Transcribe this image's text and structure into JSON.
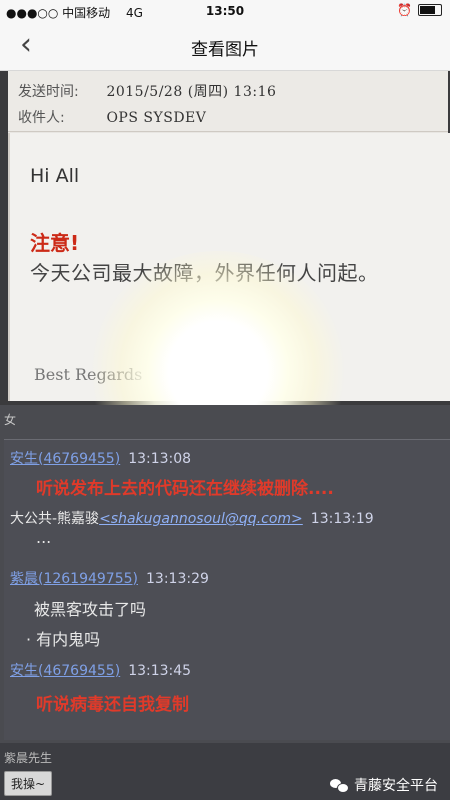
{
  "status_bar": {
    "carrier": "●●●○○ 中国移动",
    "network": "4G",
    "time": "13:50"
  },
  "nav": {
    "back_icon": "chevron-left-icon",
    "title": "查看图片"
  },
  "email": {
    "send_time_label": "发送时间:",
    "send_time_value": "2015/5/28 (周四) 13:16",
    "recipient_label": "收件人:",
    "recipient_value": "OPS SYSDEV",
    "greeting": "Hi All",
    "notice": "注意!",
    "line1": "今天公司最大故障，外界任何人问起。",
    "closing": "Best Regards"
  },
  "chat": {
    "title": "女",
    "messages": [
      {
        "sender": "安生(46769455)",
        "time": "13:13:08",
        "text": "听说发布上去的代码还在继续被删除...."
      },
      {
        "sender": "大公共-熊嘉骏",
        "email": "<shakugannosoul@qq.com>",
        "time": "13:13:19",
        "text": "..."
      },
      {
        "sender": "紫晨(1261949755)",
        "time": "13:13:29",
        "text": "被黑客攻击了吗",
        "text2": "· 有内鬼吗"
      },
      {
        "sender": "安生(46769455)",
        "time": "13:13:45",
        "text": "听说病毒还自我复制"
      }
    ],
    "footer_label": "紫晨先生",
    "reply_button": "我操~"
  },
  "watermark": "青藤安全平台"
}
